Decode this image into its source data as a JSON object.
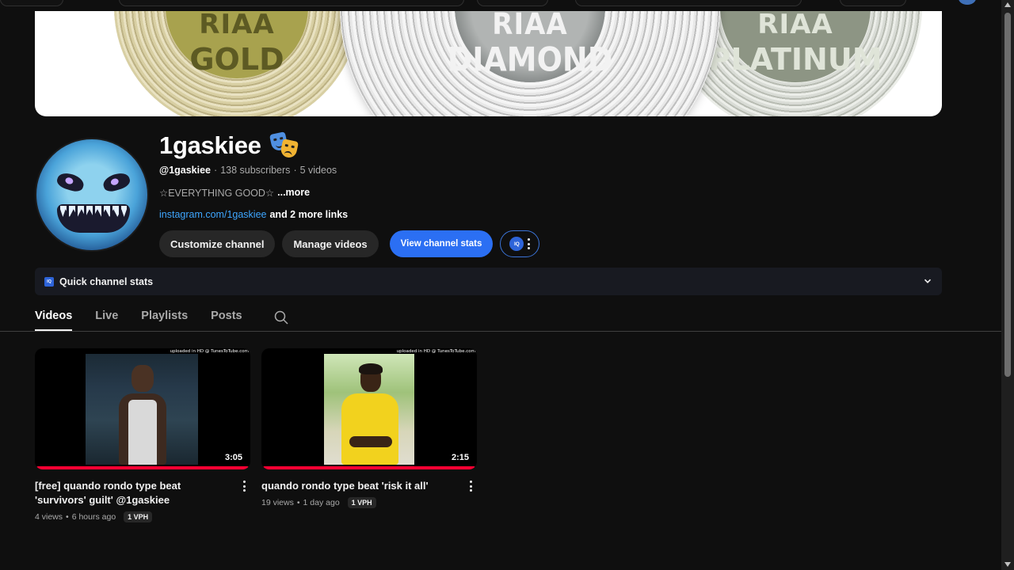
{
  "channel": {
    "name": "1gaskiee",
    "handle": "@1gaskiee",
    "subscribers": "138 subscribers",
    "video_count": "5 videos",
    "description": "☆EVERYTHING GOOD☆",
    "more_label": "...more",
    "link": "instagram.com/1gaskiee",
    "more_links": "and 2 more links",
    "name_badge_icon": "performing-arts-masks-icon"
  },
  "banner": {
    "record_left": {
      "line1": "RIAA",
      "line2": "GOLD"
    },
    "record_center": {
      "line1": "RIAA",
      "line2": "DIAMOND"
    },
    "record_right": {
      "line1": "RIAA",
      "line2": "PLATINUM"
    }
  },
  "buttons": {
    "customize": "Customize channel",
    "manage": "Manage videos",
    "stats": "View channel stats",
    "iq_badge": "IQ"
  },
  "quick_stats": {
    "label": "Quick channel stats",
    "icon_text": "IQ"
  },
  "tabs": [
    {
      "label": "Videos",
      "active": true
    },
    {
      "label": "Live",
      "active": false
    },
    {
      "label": "Playlists",
      "active": false
    },
    {
      "label": "Posts",
      "active": false
    }
  ],
  "videos": [
    {
      "title": "[free] quando rondo type beat 'survivors' guilt' @1gaskiee",
      "views": "4 views",
      "age": "6 hours ago",
      "vph": "1 VPH",
      "duration": "3:05",
      "watermark": "uploaded in HD @ TunesToTube.com"
    },
    {
      "title": "quando rondo type beat 'risk it all'",
      "views": "19 views",
      "age": "1 day ago",
      "vph": "1 VPH",
      "duration": "2:15",
      "watermark": "uploaded in HD @ TunesToTube.com"
    }
  ],
  "colors": {
    "background": "#0f0f0f",
    "accent_blue": "#2b6ff3",
    "link_blue": "#3ea6ff",
    "progress_red": "#ff0033"
  }
}
